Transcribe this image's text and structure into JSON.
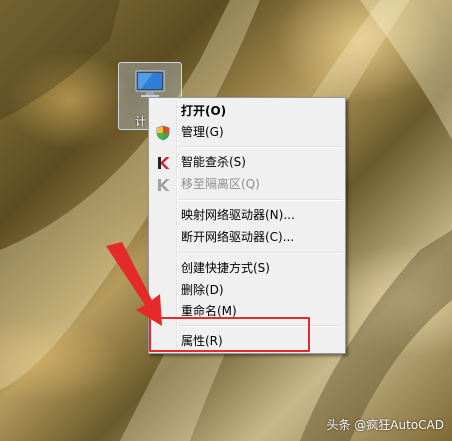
{
  "desktop": {
    "icon": {
      "name": "computer-icon",
      "caption": "计"
    }
  },
  "context_menu": {
    "items": [
      {
        "label": "打开(O)",
        "style": "bold"
      },
      {
        "label": "管理(G)",
        "icon": "uac-shield-icon"
      },
      {
        "label": "智能查杀(S)",
        "icon": "antivirus-k-icon"
      },
      {
        "label": "移至隔离区(Q)",
        "icon": "antivirus-k-gray-icon",
        "style": "disabled"
      },
      {
        "label": "映射网络驱动器(N)..."
      },
      {
        "label": "断开网络驱动器(C)..."
      },
      {
        "label": "创建快捷方式(S)"
      },
      {
        "label": "删除(D)"
      },
      {
        "label": "重命名(M)"
      },
      {
        "label": "属性(R)"
      }
    ]
  },
  "annotation": {
    "highlight_color": "#e52a2a",
    "arrow_color": "#e52a2a"
  },
  "watermark": {
    "text": "头条 @疯狂AutoCAD"
  }
}
